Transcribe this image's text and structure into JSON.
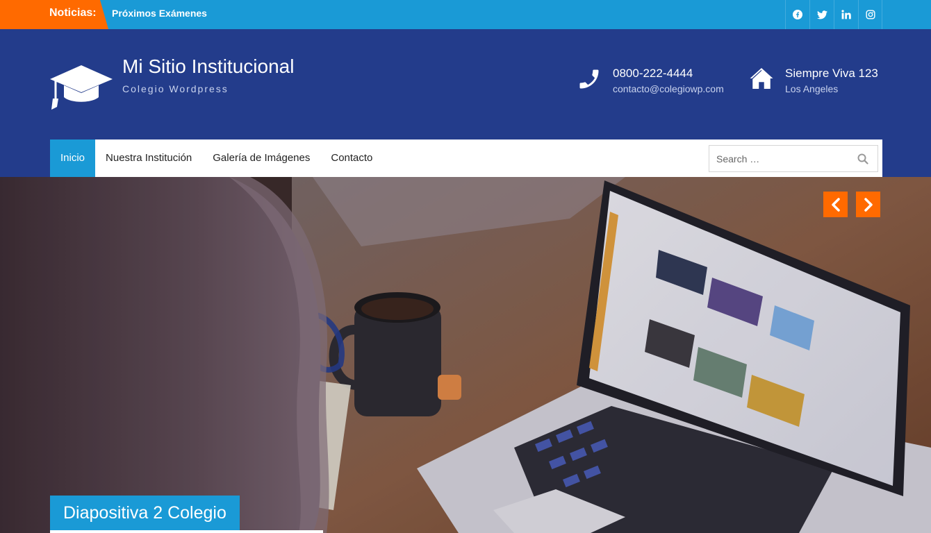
{
  "topbar": {
    "news_label": "Noticias:",
    "news_item": "Próximos Exámenes",
    "social": [
      {
        "icon": "facebook-icon"
      },
      {
        "icon": "twitter-icon"
      },
      {
        "icon": "linkedin-icon"
      },
      {
        "icon": "instagram-icon"
      }
    ]
  },
  "header": {
    "site_title": "Mi Sitio Institucional",
    "site_description": "Colegio Wordpress",
    "phone": {
      "icon": "phone-icon",
      "line1": "0800-222-4444",
      "line2": "contacto@colegiowp.com"
    },
    "address": {
      "icon": "home-icon",
      "line1": "Siempre Viva 123",
      "line2": "Los Angeles"
    }
  },
  "nav": {
    "items": [
      {
        "label": "Inicio",
        "active": true
      },
      {
        "label": "Nuestra Institución"
      },
      {
        "label": "Galería de Imágenes"
      },
      {
        "label": "Contacto"
      }
    ],
    "search_placeholder": "Search …"
  },
  "slider": {
    "caption": "Diapositiva 2 Colegio"
  },
  "colors": {
    "topbar": "#1a9ad6",
    "accent_orange": "#ff6a00",
    "header": "#233c8b",
    "nav_active": "#1a9ad6"
  }
}
